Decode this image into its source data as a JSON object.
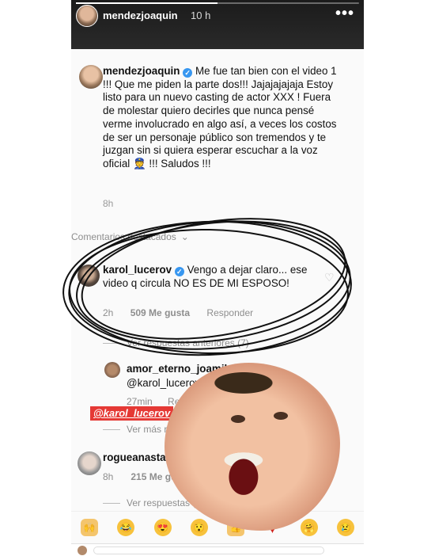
{
  "story": {
    "header": {
      "username": "mendezjoaquin",
      "time": "10 h",
      "more_icon": "more-dots-icon",
      "progress_fraction": 0.5
    },
    "post": {
      "username": "mendezjoaquin",
      "text": "Me fue tan bien con el video 1 !!! Que me piden la parte dos!!! Jajajajajaja Estoy listo para un nuevo casting de actor XXX ! Fuera de molestar quiero decirles que nunca pensé verme involucrado en algo así, a veces los costos de ser un personaje público son tremendos y te juzgan sin si quiera esperar escuchar a la voz oficial",
      "text_suffix": "!!! Saludos !!!",
      "time": "8h"
    },
    "featured_label": "Comentarios destacados",
    "comment1": {
      "username": "karol_lucerov",
      "text": "Vengo a dejar claro... ese video q circula NO ES DE MI ESPOSO!",
      "time": "2h",
      "likes": "509 Me gusta",
      "reply": "Responder"
    },
    "view_previous": "Ver respuestas anteriores (7)",
    "reply1": {
      "username": "amor_eterno_joamila",
      "text": "@karol_lucerov csm",
      "time": "27min",
      "reply": "Responder"
    },
    "mention_tag": "@karol_lucerov",
    "view_more": "Ver más respuestas",
    "comment2": {
      "username": "rogueanastasia",
      "time": "8h",
      "likes": "215 Me gusta"
    },
    "view_previous2": "Ver respuestas (3)",
    "reactions": [
      "raised-hands-icon",
      "tears-of-joy-icon",
      "heart-eyes-icon",
      "hushed-face-icon",
      "thumbs-up-icon",
      "red-heart-icon",
      "hugging-face-icon",
      "crying-face-icon"
    ]
  },
  "colors": {
    "verified": "#3897f0",
    "mention_bg": "#e53935",
    "heart": "#ed4956"
  }
}
